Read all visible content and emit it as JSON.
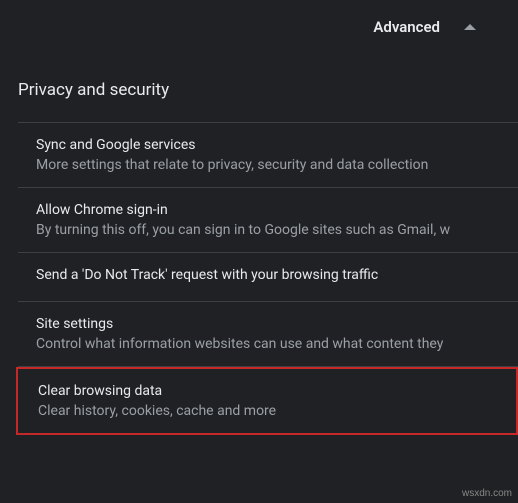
{
  "header": {
    "advanced_label": "Advanced"
  },
  "section": {
    "title": "Privacy and security"
  },
  "items": [
    {
      "title": "Sync and Google services",
      "description": "More settings that relate to privacy, security and data collection"
    },
    {
      "title": "Allow Chrome sign-in",
      "description": "By turning this off, you can sign in to Google sites such as Gmail, w"
    },
    {
      "title": "Send a 'Do Not Track' request with your browsing traffic",
      "description": ""
    },
    {
      "title": "Site settings",
      "description": "Control what information websites can use and what content they"
    },
    {
      "title": "Clear browsing data",
      "description": "Clear history, cookies, cache and more"
    }
  ],
  "watermark": "wsxdn.com"
}
